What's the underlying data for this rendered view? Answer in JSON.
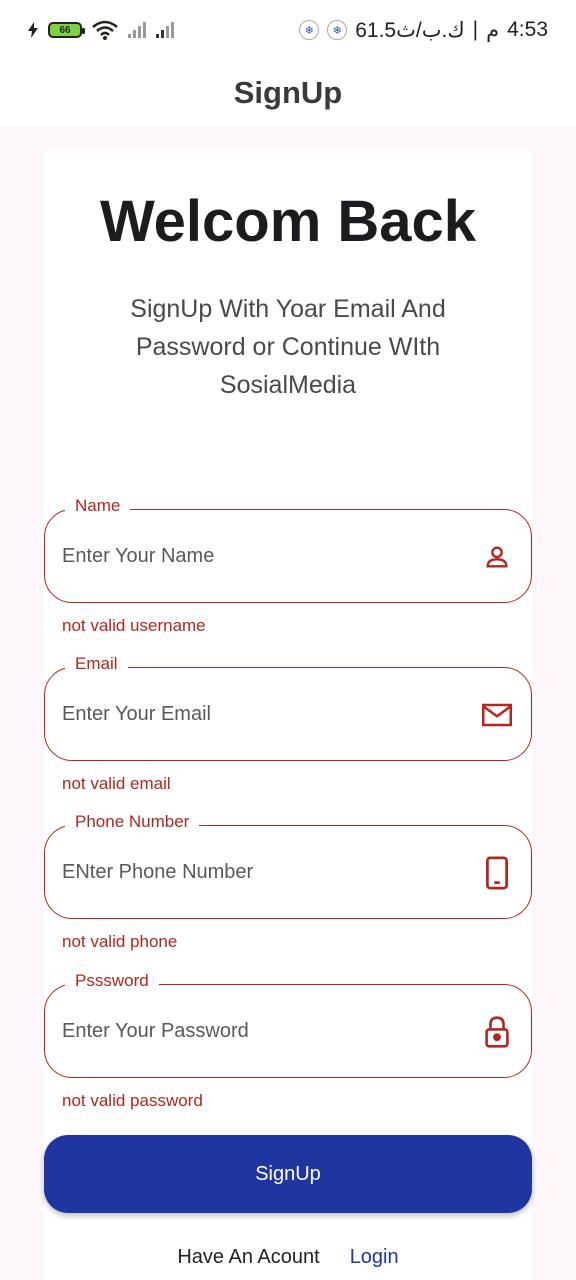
{
  "status_bar": {
    "battery_level": "66",
    "time": "4:53",
    "ampm": "م",
    "separator": "|",
    "speed": "61.5ك.ب/ث"
  },
  "app_bar": {
    "title": "SignUp"
  },
  "header": {
    "welcome": "Welcom Back",
    "subtitle": "SignUp With Yoar Email And Password or Continue WIth SosialMedia"
  },
  "fields": {
    "name": {
      "label": "Name",
      "placeholder": "Enter Your Name",
      "error": "not valid username",
      "icon": "person-icon"
    },
    "email": {
      "label": "Email",
      "placeholder": "Enter Your Email",
      "error": "not valid email",
      "icon": "mail-icon"
    },
    "phone": {
      "label": "Phone Number",
      "placeholder": "ENter Phone Number",
      "error": "not valid phone",
      "icon": "phone-icon"
    },
    "password": {
      "label": "Psssword",
      "placeholder": "Enter Your Password",
      "error": "not valid password",
      "icon": "lock-icon"
    }
  },
  "actions": {
    "signup_label": "SignUp",
    "have_account": "Have An Acount",
    "login_label": "Login"
  },
  "colors": {
    "error": "#b3261e",
    "primary": "#1f36a0",
    "background": "#fdf7fc"
  }
}
